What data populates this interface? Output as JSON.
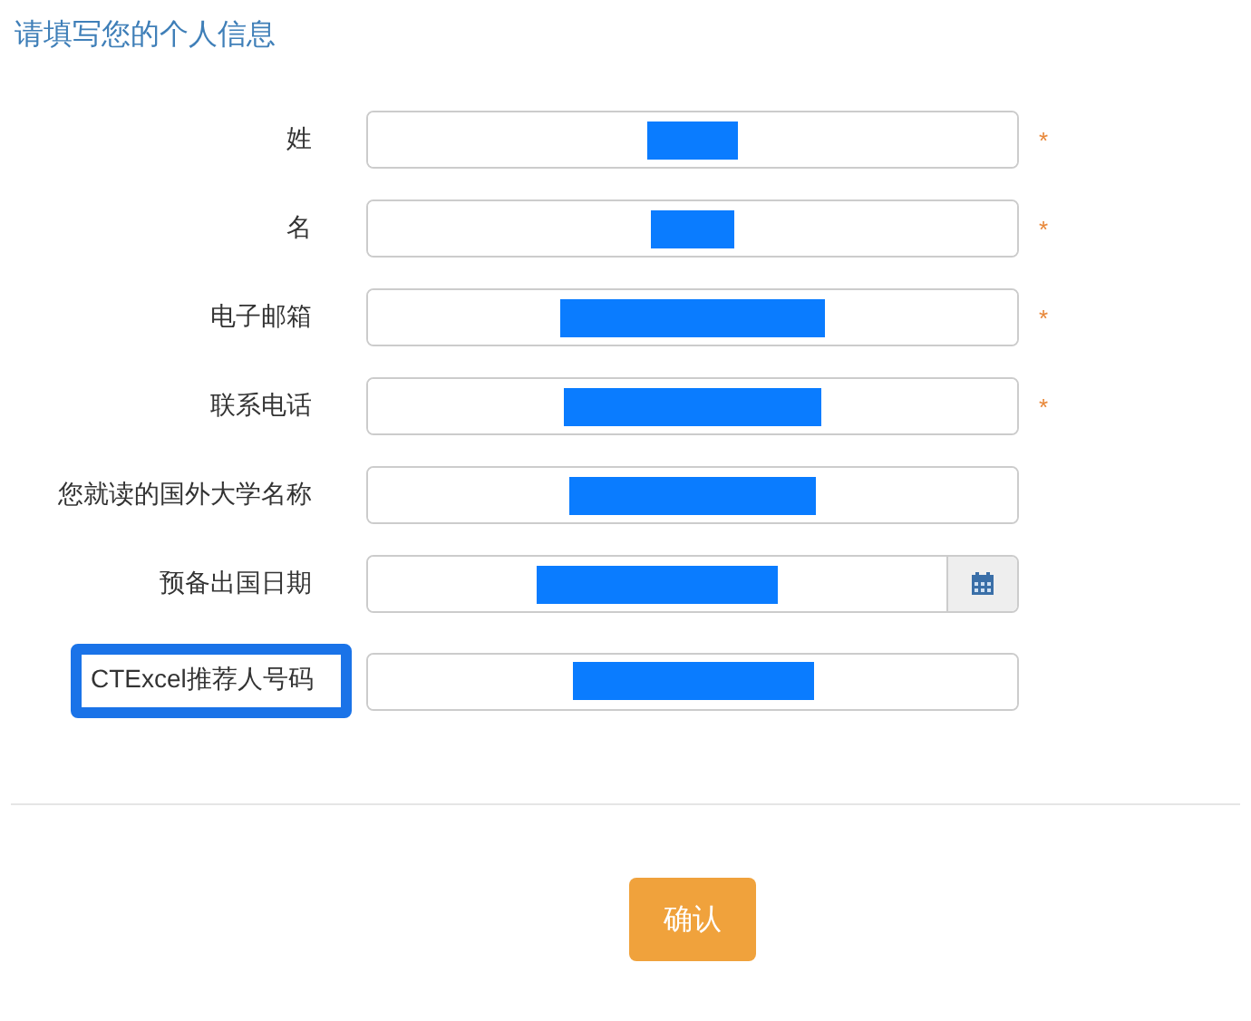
{
  "title": "请填写您的个人信息",
  "fields": [
    {
      "label": "姓",
      "kind": "text",
      "required": true,
      "redacted": true,
      "highlighted": false
    },
    {
      "label": "名",
      "kind": "text",
      "required": true,
      "redacted": true,
      "highlighted": false
    },
    {
      "label": "电子邮箱",
      "kind": "text",
      "required": true,
      "redacted": true,
      "highlighted": false
    },
    {
      "label": "联系电话",
      "kind": "text",
      "required": true,
      "redacted": true,
      "highlighted": false
    },
    {
      "label": "您就读的国外大学名称",
      "kind": "text",
      "required": false,
      "redacted": true,
      "highlighted": false
    },
    {
      "label": "预备出国日期",
      "kind": "date",
      "required": false,
      "redacted": true,
      "highlighted": false
    },
    {
      "label": "CTExcel推荐人号码",
      "kind": "text",
      "required": false,
      "redacted": true,
      "highlighted": true
    }
  ],
  "required_mark": "*",
  "submit": "确认"
}
